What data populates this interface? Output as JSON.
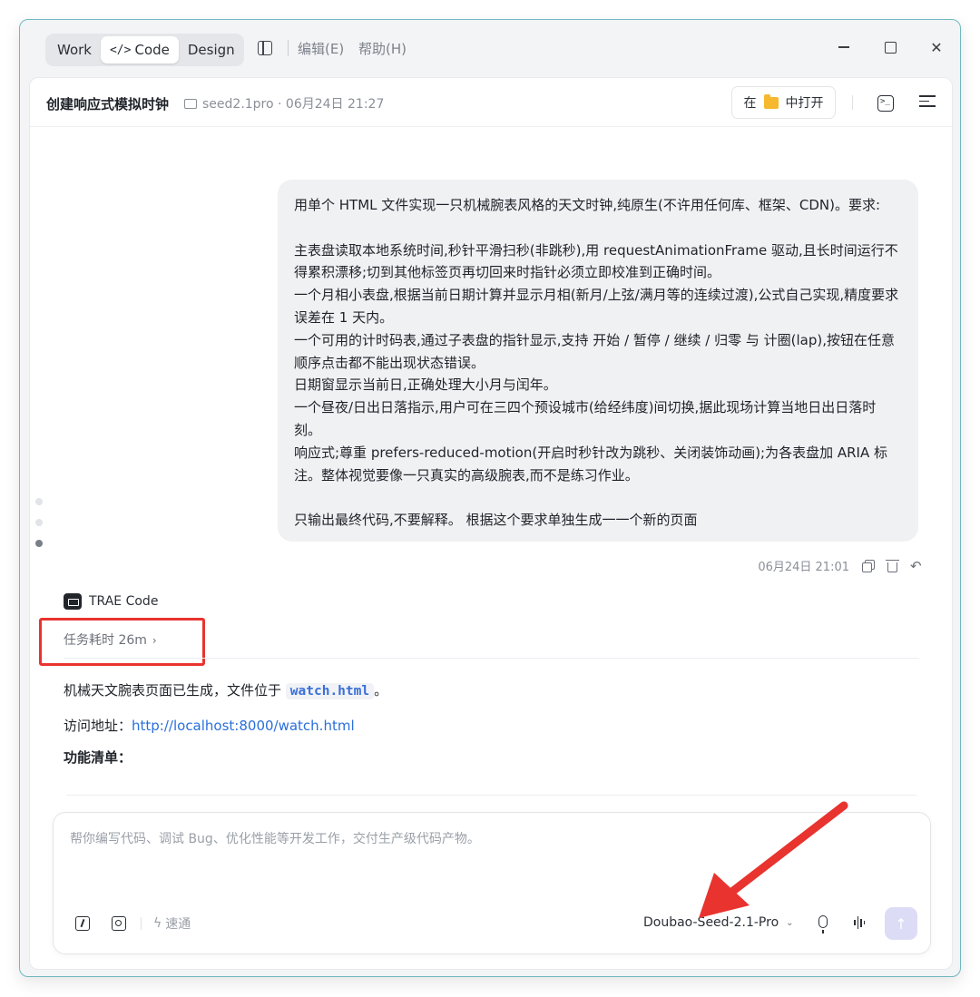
{
  "titlebar": {
    "modes": [
      "Work",
      "Code",
      "Design"
    ],
    "active_mode": "Code",
    "code_glyph": "</>",
    "menu": {
      "edit": "编辑(E)",
      "help": "帮助(H)"
    }
  },
  "header": {
    "title": "创建响应式模拟时钟",
    "meta": "seed2.1pro · 06月24日 21:27",
    "open_in_prefix": "在",
    "open_in_suffix": "中打开"
  },
  "user_message": {
    "lines": [
      "用单个 HTML 文件实现一只机械腕表风格的天文时钟,纯原生(不许用任何库、框架、CDN)。要求:",
      "",
      "主表盘读取本地系统时间,秒针平滑扫秒(非跳秒),用 requestAnimationFrame 驱动,且长时间运行不得累积漂移;切到其他标签页再切回来时指针必须立即校准到正确时间。",
      "一个月相小表盘,根据当前日期计算并显示月相(新月/上弦/满月等的连续过渡),公式自己实现,精度要求误差在 1 天内。",
      "一个可用的计时码表,通过子表盘的指针显示,支持 开始 / 暂停 / 继续 / 归零 与 计圈(lap),按钮在任意顺序点击都不能出现状态错误。",
      "日期窗显示当前日,正确处理大小月与闰年。",
      "一个昼夜/日出日落指示,用户可在三四个预设城市(给经纬度)间切换,据此现场计算当地日出日落时刻。",
      "响应式;尊重 prefers-reduced-motion(开启时秒针改为跳秒、关闭装饰动画);为各表盘加 ARIA 标注。整体视觉要像一只真实的高级腕表,而不是练习作业。",
      "",
      "只输出最终代码,不要解释。  根据这个要求单独生成一一个新的页面"
    ],
    "timestamp": "06月24日 21:01"
  },
  "assistant": {
    "name": "TRAE Code",
    "task_duration": "任务耗时 26m",
    "reply_prefix": "机械天文腕表页面已生成，文件位于",
    "reply_file": "watch.html",
    "reply_suffix": "。",
    "url_label": "访问地址：",
    "url": "http://localhost:8000/watch.html",
    "features_heading": "功能清单："
  },
  "composer": {
    "placeholder": "帮你编写代码、调试 Bug、优化性能等开发工作，交付生产级代码产物。",
    "speed_label": "速通",
    "model": "Doubao-Seed-2.1-Pro"
  },
  "colors": {
    "annotation_red": "#e8332f",
    "link_blue": "#2a6fdb",
    "send_disabled": "#dcdcf7"
  }
}
